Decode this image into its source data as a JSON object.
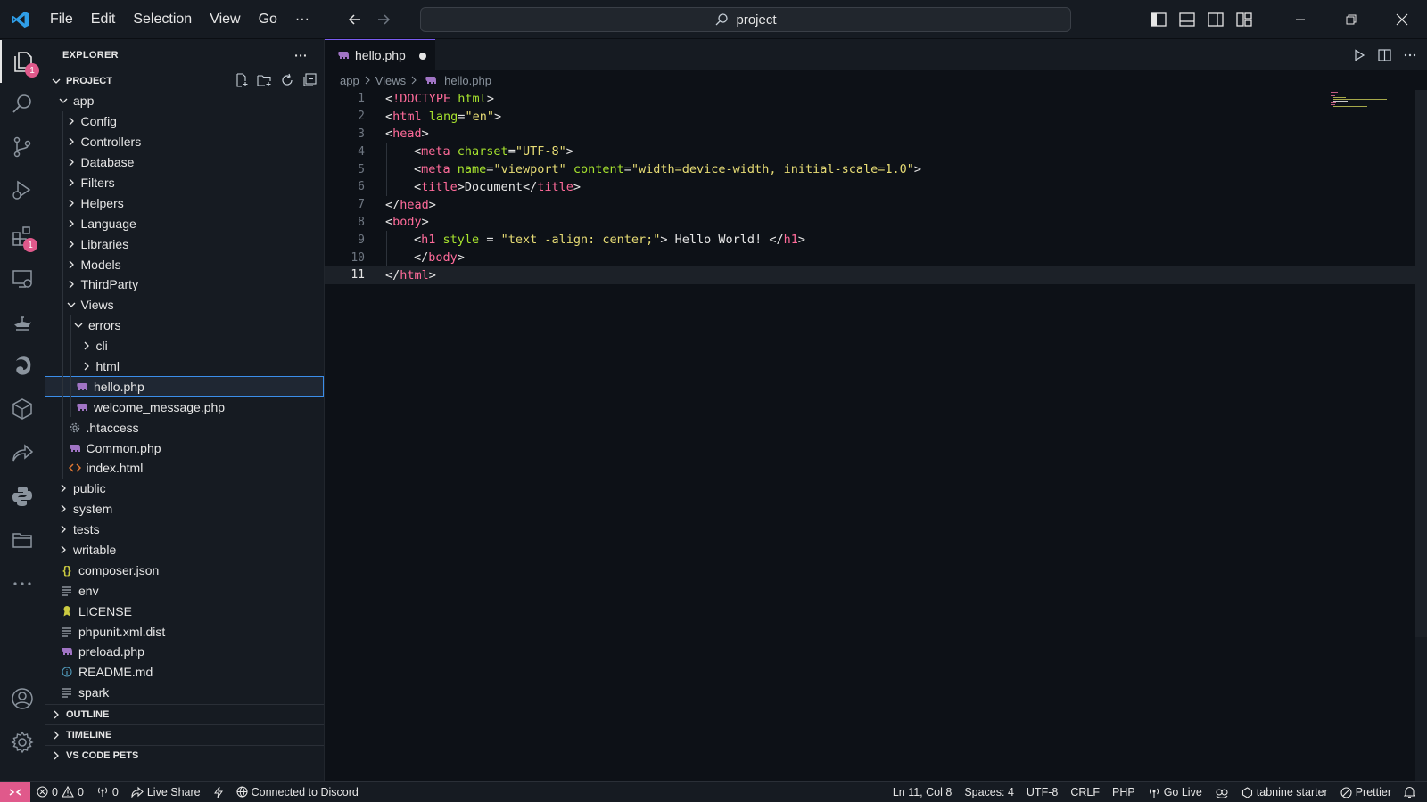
{
  "titlebar": {
    "menu": [
      "File",
      "Edit",
      "Selection",
      "View",
      "Go",
      "···"
    ],
    "search_text": "project"
  },
  "sidebar": {
    "title": "EXPLORER",
    "more": "···",
    "project_label": "PROJECT",
    "tree": [
      {
        "label": "app",
        "level": 1,
        "kind": "folder",
        "open": true
      },
      {
        "label": "Config",
        "level": 2,
        "kind": "folder",
        "open": false
      },
      {
        "label": "Controllers",
        "level": 2,
        "kind": "folder",
        "open": false
      },
      {
        "label": "Database",
        "level": 2,
        "kind": "folder",
        "open": false
      },
      {
        "label": "Filters",
        "level": 2,
        "kind": "folder",
        "open": false
      },
      {
        "label": "Helpers",
        "level": 2,
        "kind": "folder",
        "open": false
      },
      {
        "label": "Language",
        "level": 2,
        "kind": "folder",
        "open": false
      },
      {
        "label": "Libraries",
        "level": 2,
        "kind": "folder",
        "open": false
      },
      {
        "label": "Models",
        "level": 2,
        "kind": "folder",
        "open": false
      },
      {
        "label": "ThirdParty",
        "level": 2,
        "kind": "folder",
        "open": false
      },
      {
        "label": "Views",
        "level": 2,
        "kind": "folder",
        "open": true
      },
      {
        "label": "errors",
        "level": 3,
        "kind": "folder",
        "open": true
      },
      {
        "label": "cli",
        "level": 4,
        "kind": "folder",
        "open": false
      },
      {
        "label": "html",
        "level": 4,
        "kind": "folder",
        "open": false
      },
      {
        "label": "hello.php",
        "level": 3,
        "kind": "php",
        "selected": true
      },
      {
        "label": "welcome_message.php",
        "level": 3,
        "kind": "php"
      },
      {
        "label": ".htaccess",
        "level": 2,
        "kind": "gear"
      },
      {
        "label": "Common.php",
        "level": 2,
        "kind": "php"
      },
      {
        "label": "index.html",
        "level": 2,
        "kind": "html"
      },
      {
        "label": "public",
        "level": 1,
        "kind": "folder",
        "open": false
      },
      {
        "label": "system",
        "level": 1,
        "kind": "folder",
        "open": false
      },
      {
        "label": "tests",
        "level": 1,
        "kind": "folder",
        "open": false
      },
      {
        "label": "writable",
        "level": 1,
        "kind": "folder",
        "open": false
      },
      {
        "label": "composer.json",
        "level": 1,
        "kind": "json"
      },
      {
        "label": "env",
        "level": 1,
        "kind": "text"
      },
      {
        "label": "LICENSE",
        "level": 1,
        "kind": "license"
      },
      {
        "label": "phpunit.xml.dist",
        "level": 1,
        "kind": "text"
      },
      {
        "label": "preload.php",
        "level": 1,
        "kind": "php"
      },
      {
        "label": "README.md",
        "level": 1,
        "kind": "info"
      },
      {
        "label": "spark",
        "level": 1,
        "kind": "text"
      }
    ],
    "sections": [
      "OUTLINE",
      "TIMELINE",
      "VS CODE PETS"
    ]
  },
  "editor": {
    "tab_label": "hello.php",
    "breadcrumb": [
      "app",
      "Views",
      "hello.php"
    ],
    "current_line": 11,
    "lines": [
      {
        "n": "1",
        "indent": 0,
        "tokens": [
          [
            "br",
            "<"
          ],
          [
            "doc",
            "!DOCTYPE"
          ],
          [
            "attr",
            " html"
          ],
          [
            "br",
            ">"
          ]
        ]
      },
      {
        "n": "2",
        "indent": 0,
        "tokens": [
          [
            "br",
            "<"
          ],
          [
            "tag",
            "html"
          ],
          [
            "attr",
            " lang"
          ],
          [
            "br",
            "="
          ],
          [
            "str",
            "\"en\""
          ],
          [
            "br",
            ">"
          ]
        ]
      },
      {
        "n": "3",
        "indent": 0,
        "tokens": [
          [
            "br",
            "<"
          ],
          [
            "tag",
            "head"
          ],
          [
            "br",
            ">"
          ]
        ]
      },
      {
        "n": "4",
        "indent": 1,
        "tokens": [
          [
            "br",
            "<"
          ],
          [
            "tag",
            "meta"
          ],
          [
            "attr",
            " charset"
          ],
          [
            "br",
            "="
          ],
          [
            "str",
            "\"UTF-8\""
          ],
          [
            "br",
            ">"
          ]
        ]
      },
      {
        "n": "5",
        "indent": 1,
        "tokens": [
          [
            "br",
            "<"
          ],
          [
            "tag",
            "meta"
          ],
          [
            "attr",
            " name"
          ],
          [
            "br",
            "="
          ],
          [
            "str",
            "\"viewport\""
          ],
          [
            "attr",
            " content"
          ],
          [
            "br",
            "="
          ],
          [
            "str",
            "\"width=device-width, initial-scale=1.0\""
          ],
          [
            "br",
            ">"
          ]
        ]
      },
      {
        "n": "6",
        "indent": 1,
        "tokens": [
          [
            "br",
            "<"
          ],
          [
            "tag",
            "title"
          ],
          [
            "br",
            ">"
          ],
          [
            "txt",
            "Document"
          ],
          [
            "br",
            "</"
          ],
          [
            "tag",
            "title"
          ],
          [
            "br",
            ">"
          ]
        ]
      },
      {
        "n": "7",
        "indent": 0,
        "tokens": [
          [
            "br",
            "</"
          ],
          [
            "tag",
            "head"
          ],
          [
            "br",
            ">"
          ]
        ]
      },
      {
        "n": "8",
        "indent": 0,
        "tokens": [
          [
            "br",
            "<"
          ],
          [
            "tag",
            "body"
          ],
          [
            "br",
            ">"
          ]
        ]
      },
      {
        "n": "9",
        "indent": 1,
        "tokens": [
          [
            "br",
            "<"
          ],
          [
            "tag",
            "h1"
          ],
          [
            "attr",
            " style"
          ],
          [
            "br",
            " = "
          ],
          [
            "str",
            "\"text -align: center;\""
          ],
          [
            "br",
            ">"
          ],
          [
            "txt",
            " Hello World! "
          ],
          [
            "br",
            "</"
          ],
          [
            "tag",
            "h1"
          ],
          [
            "br",
            ">"
          ]
        ]
      },
      {
        "n": "10",
        "indent": 1,
        "tokens": [
          [
            "br",
            "</"
          ],
          [
            "tag",
            "body"
          ],
          [
            "br",
            ">"
          ]
        ]
      },
      {
        "n": "11",
        "indent": 0,
        "tokens": [
          [
            "br",
            "</"
          ],
          [
            "tag",
            "html"
          ],
          [
            "br",
            ">"
          ]
        ]
      }
    ]
  },
  "statusbar": {
    "errors": "0",
    "warnings": "0",
    "ports": "0",
    "live_share": "Live Share",
    "discord": "Connected to Discord",
    "cursor": "Ln 11, Col 8",
    "spaces": "Spaces: 4",
    "encoding": "UTF-8",
    "eol": "CRLF",
    "language": "PHP",
    "go_live": "Go Live",
    "tabnine": "tabnine starter",
    "prettier": "Prettier"
  },
  "badges": {
    "explorer": "1",
    "extensions": "1"
  },
  "colors": {
    "accent": "#e0598b",
    "tag": "#ff6b9a",
    "attr": "#a6e22e",
    "string": "#e6db74",
    "php_icon": "#a074c4"
  }
}
